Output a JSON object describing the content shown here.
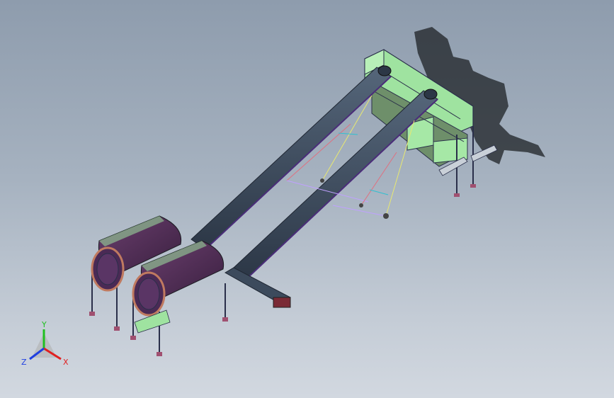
{
  "triad": {
    "x_label": "X",
    "y_label": "Y",
    "z_label": "Z",
    "x_color": "#e02020",
    "y_color": "#20c020",
    "z_color": "#2040e0"
  },
  "model": {
    "frame_color": "#2a2f4a",
    "panel_green": "#9fe3a0",
    "drum_purple": "#4a2a55",
    "conveyor_color": "#3c4a5c",
    "foot_color": "#a05070"
  }
}
